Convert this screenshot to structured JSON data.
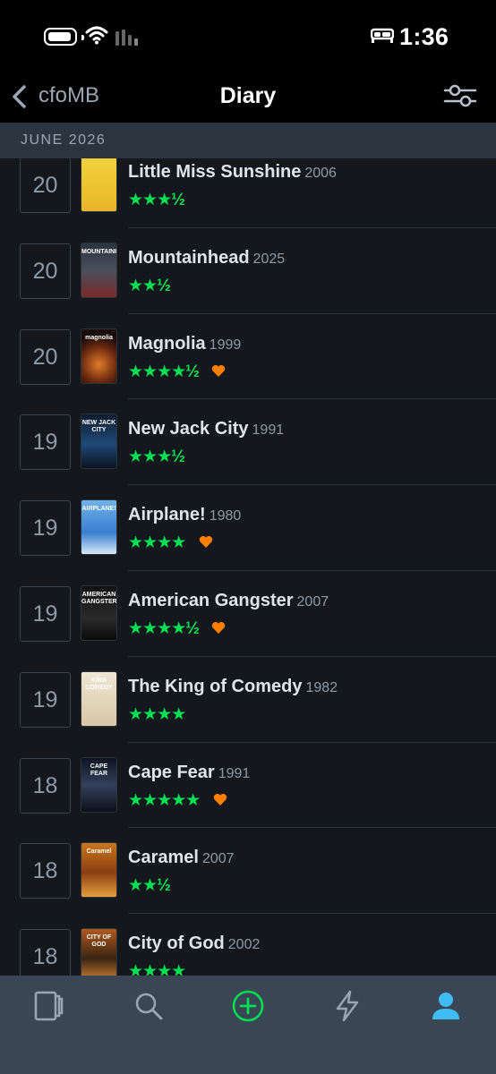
{
  "status_bar": {
    "time": "1:36"
  },
  "nav": {
    "back_label": "cfoMB",
    "title": "Diary"
  },
  "section": {
    "label": "JUNE 2026"
  },
  "colors": {
    "star": "#00e054",
    "heart": "#ff8000",
    "active_tab": "#40bcf4",
    "add_tab": "#00e054"
  },
  "entries": [
    {
      "day": "20",
      "title": "Little Miss Sunshine",
      "year": "2006",
      "stars": "★★★½",
      "liked": false,
      "poster_text": "",
      "poster_bg": "linear-gradient(#f2d33a,#e8b52a)"
    },
    {
      "day": "20",
      "title": "Mountainhead",
      "year": "2025",
      "stars": "★★½",
      "liked": false,
      "poster_text": "MOUNTAINHEAD",
      "poster_bg": "linear-gradient(#2b3240,#4a4f5c 50%,#7a2a2a)"
    },
    {
      "day": "20",
      "title": "Magnolia",
      "year": "1999",
      "stars": "★★★★½",
      "liked": true,
      "poster_text": "magnolia",
      "poster_bg": "radial-gradient(circle at 50% 65%,#e07a2c,#6b2a10 45%,#1a0c08 75%)"
    },
    {
      "day": "19",
      "title": "New Jack City",
      "year": "1991",
      "stars": "★★★½",
      "liked": false,
      "poster_text": "NEW JACK CITY",
      "poster_bg": "linear-gradient(#0d1a2e,#1f4a78 55%,#0a1220)"
    },
    {
      "day": "19",
      "title": "Airplane!",
      "year": "1980",
      "stars": "★★★★",
      "liked": true,
      "poster_text": "AIRPLANE!",
      "poster_bg": "linear-gradient(#6fb2e8,#3a7fd0 60%,#d7e8f6)"
    },
    {
      "day": "19",
      "title": "American Gangster",
      "year": "2007",
      "stars": "★★★★½",
      "liked": true,
      "poster_text": "AMERICAN GANGSTER",
      "poster_bg": "linear-gradient(#111,#2a2a2a 60%,#0a0a0a)"
    },
    {
      "day": "19",
      "title": "The King of Comedy",
      "year": "1982",
      "stars": "★★★★",
      "liked": false,
      "poster_text": "KING COMEDY",
      "poster_bg": "linear-gradient(#efe6d4,#d8c7a6)"
    },
    {
      "day": "18",
      "title": "Cape Fear",
      "year": "1991",
      "stars": "★★★★★",
      "liked": true,
      "poster_text": "CAPE FEAR",
      "poster_bg": "linear-gradient(#0c1222,#34405a 50%,#0c0f18)"
    },
    {
      "day": "18",
      "title": "Caramel",
      "year": "2007",
      "stars": "★★½",
      "liked": false,
      "poster_text": "Caramel",
      "poster_bg": "linear-gradient(#c8761c,#8a3e10 55%,#e4a040)"
    },
    {
      "day": "18",
      "title": "City of God",
      "year": "2002",
      "stars": "★★★★",
      "liked": false,
      "poster_text": "CITY OF GOD",
      "poster_bg": "linear-gradient(#b05a1e,#3a2410 55%,#d88a3a)"
    }
  ],
  "tabs": [
    {
      "name": "diary-tab",
      "icon": "film-strip-icon"
    },
    {
      "name": "search-tab",
      "icon": "search-icon"
    },
    {
      "name": "add-tab",
      "icon": "plus-circle-icon"
    },
    {
      "name": "activity-tab",
      "icon": "lightning-icon"
    },
    {
      "name": "profile-tab",
      "icon": "person-icon"
    }
  ]
}
